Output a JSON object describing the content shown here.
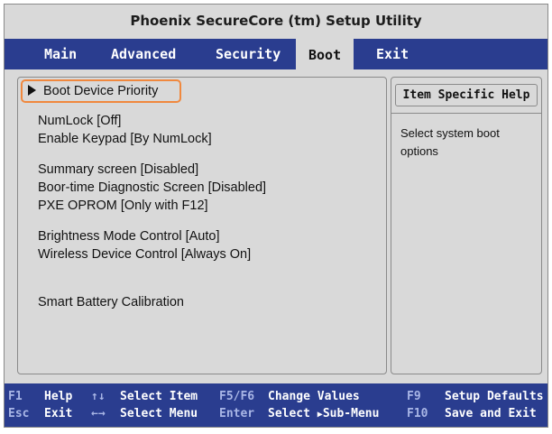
{
  "title": "Phoenix SecureCore (tm) Setup Utility",
  "menu": {
    "tabs": [
      "Main",
      "Advanced",
      "Security",
      "Boot",
      "Exit"
    ],
    "active": "Boot"
  },
  "items": {
    "boot_device_priority": "Boot Device Priority",
    "numlock": "NumLock [Off]",
    "enable_keypad": "Enable Keypad [By NumLock]",
    "summary_screen": "Summary screen [Disabled]",
    "boot_diag": "Boor-time Diagnostic Screen [Disabled]",
    "pxe_oprom": "PXE OPROM [Only with F12]",
    "brightness": "Brightness Mode Control [Auto]",
    "wireless": "Wireless Device Control [Always On]",
    "battery": "Smart Battery Calibration"
  },
  "help": {
    "title": "Item Specific Help",
    "text": "Select system boot options"
  },
  "footer": {
    "f1": "F1",
    "help": "Help",
    "esc": "Esc",
    "exit": "Exit",
    "updown": "↑↓",
    "select_item": "Select Item",
    "leftright": "←→",
    "select_menu": "Select Menu",
    "f5f6": "F5/F6",
    "change_values": "Change Values",
    "enter": "Enter",
    "select_sub": "Select",
    "sub_menu": "Sub-Menu",
    "f9": "F9",
    "setup_defaults": "Setup Defaults",
    "f10": "F10",
    "save_exit": "Save and Exit"
  },
  "colors": {
    "menu_bar": "#2a3d8f",
    "background": "#d9d9d9",
    "highlight_border": "#f0883e"
  }
}
